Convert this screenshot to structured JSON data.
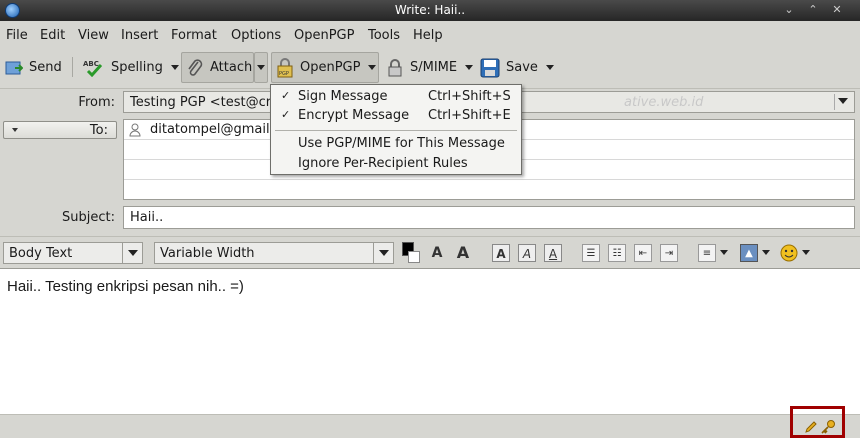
{
  "window": {
    "title": "Write: Haii..",
    "controls": [
      "⌄",
      "⌃",
      "✕"
    ]
  },
  "menubar": [
    "File",
    "Edit",
    "View",
    "Insert",
    "Format",
    "Options",
    "OpenPGP",
    "Tools",
    "Help"
  ],
  "toolbar": {
    "send": "Send",
    "spelling": "Spelling",
    "attach": "Attach",
    "openpgp": "OpenPGP",
    "smime": "S/MIME",
    "save": "Save"
  },
  "header": {
    "from_label": "From:",
    "from_value": "Testing PGP <test@cr",
    "from_ghost": "ative.web.id",
    "to_label": "To:",
    "recipient": "ditatompel@gmail.",
    "subject_label": "Subject:",
    "subject_value": "Haii.."
  },
  "format": {
    "paragraph": "Body Text",
    "font": "Variable Width"
  },
  "body": {
    "text": "Haii.. Testing enkripsi pesan nih.. =)"
  },
  "openpgp_menu": {
    "items": [
      {
        "label": "Sign Message",
        "accel": "Ctrl+Shift+S",
        "checked": true
      },
      {
        "label": "Encrypt Message",
        "accel": "Ctrl+Shift+E",
        "checked": true
      },
      {
        "label": "Use PGP/MIME for This Message",
        "accel": "",
        "checked": false
      },
      {
        "label": "Ignore Per-Recipient Rules",
        "accel": "",
        "checked": false
      }
    ]
  },
  "colors": {
    "titlebar": "#262626",
    "highlight": "#a00000",
    "chrome": "#d6d6d1"
  }
}
